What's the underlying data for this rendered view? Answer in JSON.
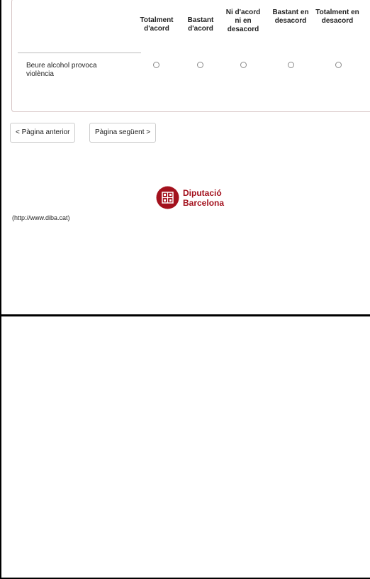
{
  "question_table": {
    "headers": [
      "Totalment d'acord",
      "Bastant d'acord",
      "Ni d'acord ni en desacord",
      "Bastant en desacord",
      "Totalment en desacord"
    ],
    "statement": "Beure alcohol provoca violència"
  },
  "navigation": {
    "previous_label": "< Pàgina anterior",
    "next_label": "Pàgina següent >"
  },
  "footer": {
    "link_text": "(http://www.diba.cat)",
    "logo_line1": "Diputació",
    "logo_line2": "Barcelona"
  },
  "colors": {
    "brand_red": "#a3111d",
    "frame_border": "#000000"
  }
}
